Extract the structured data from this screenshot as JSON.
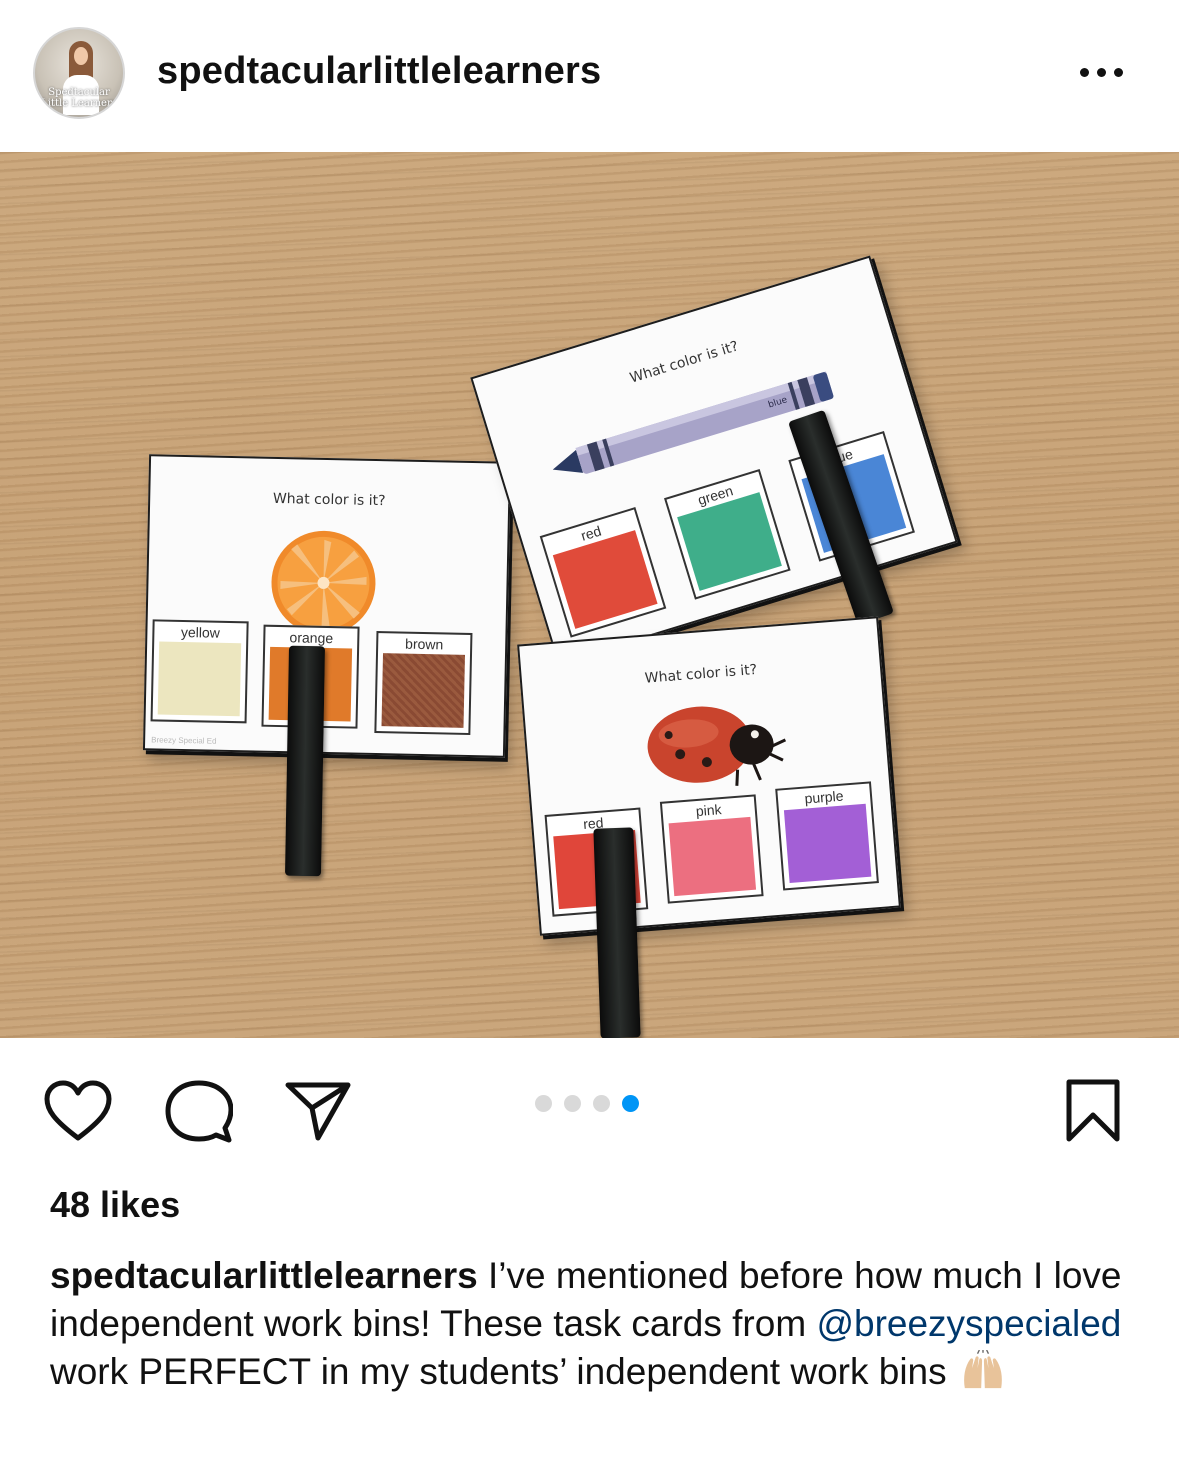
{
  "post": {
    "username": "spedtacularlittlelearners",
    "avatar_text": "Spedtacular Little Learners",
    "more_icon": "more-horizontal-icon",
    "likes_text": "48 likes",
    "caption": {
      "user": "spedtacularlittlelearners",
      "text_before_mention": " I’ve mentioned before how much I love independent work bins! These task cards from ",
      "mention": "@breezyspecialed",
      "text_after_mention": " work PERFECT in my students’ independent work bins ",
      "emoji": "raising-hands-emoji"
    },
    "carousel": {
      "count": 4,
      "active_index": 3
    }
  },
  "photo": {
    "cards": [
      {
        "question": "What color is it?",
        "picture": "orange-slice",
        "options": [
          {
            "label": "yellow",
            "color": "#ece6bf"
          },
          {
            "label": "orange",
            "color": "#e07a2a"
          },
          {
            "label": "brown",
            "color": "#8a4a33"
          }
        ],
        "footer": "Breezy Special Ed"
      },
      {
        "question": "What color is it?",
        "picture": "blue-crayon",
        "crayon_label": "blue",
        "options": [
          {
            "label": "red",
            "color": "#e04b3a"
          },
          {
            "label": "green",
            "color": "#3fae8a"
          },
          {
            "label": "blue",
            "color": "#4a86d6"
          }
        ]
      },
      {
        "question": "What color is it?",
        "picture": "ladybug",
        "options": [
          {
            "label": "red",
            "color": "#e0463a"
          },
          {
            "label": "pink",
            "color": "#ec6f80"
          },
          {
            "label": "purple",
            "color": "#a35fd6"
          }
        ]
      }
    ]
  },
  "actions": {
    "like_icon": "heart-icon",
    "comment_icon": "comment-icon",
    "share_icon": "paper-plane-icon",
    "save_icon": "bookmark-icon"
  },
  "colors": {
    "accent_blue": "#0095f6",
    "mention_blue": "#00376b",
    "dot_inactive": "#d9d9d9"
  }
}
